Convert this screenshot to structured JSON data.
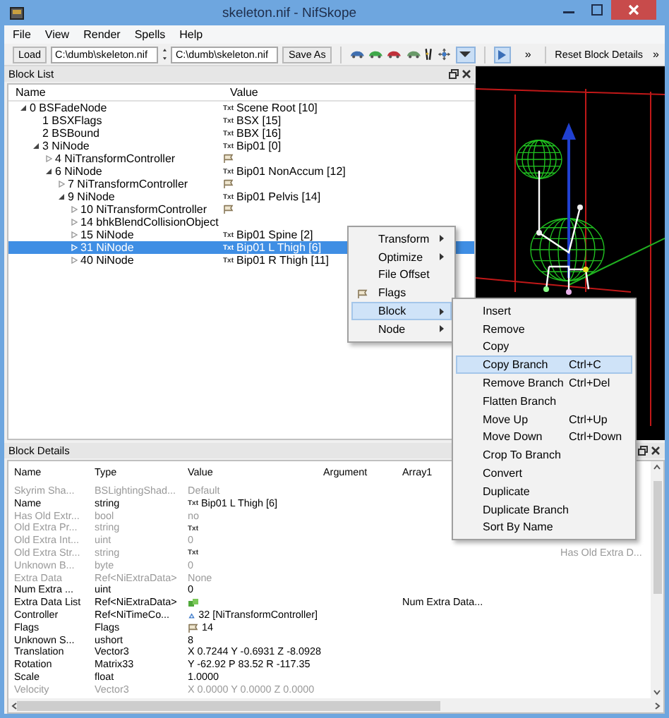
{
  "window": {
    "title": "skeleton.nif - NifSkope"
  },
  "menu": [
    "File",
    "View",
    "Render",
    "Spells",
    "Help"
  ],
  "toolbar": {
    "load": "Load",
    "fields": [
      "C:\\dumb\\skeleton.nif",
      "C:\\dumb\\skeleton.nif"
    ],
    "save": "Save As",
    "tools": [
      {
        "kind": "car",
        "color": "#3f6fb0"
      },
      {
        "kind": "car",
        "color": "#3fa84a"
      },
      {
        "kind": "car",
        "color": "#c0303a"
      },
      {
        "kind": "car",
        "color": "#6a9a6a"
      },
      {
        "kind": "figure"
      },
      {
        "kind": "move"
      },
      {
        "kind": "dropdown",
        "on": true
      }
    ],
    "play_on": true,
    "overflow": [
      "»",
      "»"
    ],
    "reset": "Reset Block Details"
  },
  "block_list": {
    "title": "Block List",
    "columns": [
      "Name",
      "Value"
    ],
    "nodes": [
      {
        "name": "0 BSFadeNode",
        "badge": "Txt",
        "value": "Scene Root [10]",
        "expanded": true,
        "selected": false,
        "children": [
          {
            "name": "1 BSXFlags",
            "badge": "Txt",
            "value": "BSX [15]",
            "selected": false
          },
          {
            "name": "2 BSBound",
            "badge": "Txt",
            "value": "BBX [16]",
            "selected": false
          },
          {
            "name": "3 NiNode",
            "badge": "Txt",
            "value": "Bip01 [0]",
            "expanded": true,
            "selected": false,
            "children": [
              {
                "name": "4 NiTransformController",
                "kind": "controller",
                "expanded": false,
                "selected": false
              },
              {
                "name": "6 NiNode",
                "badge": "Txt",
                "value": "Bip01 NonAccum [12]",
                "expanded": true,
                "selected": false,
                "children": [
                  {
                    "name": "7 NiTransformController",
                    "kind": "controller",
                    "expanded": false,
                    "selected": false
                  },
                  {
                    "name": "9 NiNode",
                    "badge": "Txt",
                    "value": "Bip01 Pelvis [14]",
                    "expanded": true,
                    "selected": false,
                    "children": [
                      {
                        "name": "10 NiTransformController",
                        "kind": "controller",
                        "expanded": false,
                        "selected": false
                      },
                      {
                        "name": "14 bhkBlendCollisionObject",
                        "expanded": false,
                        "selected": false
                      },
                      {
                        "name": "15 NiNode",
                        "badge": "Txt",
                        "value": "Bip01 Spine [2]",
                        "expanded": false,
                        "selected": false
                      },
                      {
                        "name": "31 NiNode",
                        "badge": "Txt",
                        "value": "Bip01 L Thigh [6]",
                        "expanded": false,
                        "selected": true
                      },
                      {
                        "name": "40 NiNode",
                        "badge": "Txt",
                        "value": "Bip01 R Thigh [11]",
                        "expanded": false,
                        "selected": false
                      }
                    ]
                  }
                ]
              }
            ]
          }
        ]
      }
    ]
  },
  "context_menu": [
    {
      "label": "Transform",
      "submenu": true,
      "selected": false
    },
    {
      "label": "Optimize",
      "submenu": true,
      "selected": false
    },
    {
      "label": "File Offset",
      "submenu": false,
      "selected": false
    },
    {
      "label": "Flags",
      "kind": "flags",
      "submenu": false,
      "selected": false
    },
    {
      "label": "Block",
      "submenu": true,
      "selected": true
    },
    {
      "label": "Node",
      "submenu": true,
      "selected": false
    }
  ],
  "submenu": [
    {
      "label": "Insert",
      "selected": false
    },
    {
      "label": "Remove",
      "selected": false
    },
    {
      "label": "Copy",
      "selected": false
    },
    {
      "label": "Copy Branch",
      "shortcut": "Ctrl+C",
      "selected": true
    },
    {
      "label": "Remove Branch",
      "shortcut": "Ctrl+Del",
      "selected": false
    },
    {
      "label": "Flatten Branch",
      "selected": false
    },
    {
      "label": "Move Up",
      "shortcut": "Ctrl+Up",
      "selected": false
    },
    {
      "label": "Move Down",
      "shortcut": "Ctrl+Down",
      "selected": false
    },
    {
      "label": "Crop To Branch",
      "selected": false
    },
    {
      "label": "Convert",
      "selected": false
    },
    {
      "label": "Duplicate",
      "selected": false
    },
    {
      "label": "Duplicate Branch",
      "selected": false
    },
    {
      "label": "Sort By Name",
      "selected": false
    }
  ],
  "block_details": {
    "title": "Block Details",
    "columns": [
      "Name",
      "Type",
      "Value",
      "Argument",
      "Array1"
    ],
    "rows": [
      {
        "name": "Skyrim Sha...",
        "type": "BSLightingShad...",
        "value": "Default",
        "disabled": true
      },
      {
        "name": "Name",
        "type": "string",
        "badge": "Txt",
        "value": "Bip01 L Thigh [6]",
        "disabled": false
      },
      {
        "name": "Has Old Extr...",
        "type": "bool",
        "value": "no",
        "disabled": true
      },
      {
        "name": "Old Extra Pr...",
        "type": "string",
        "badge": "Txt",
        "disabled": true
      },
      {
        "name": "Old Extra Int...",
        "type": "uint",
        "value": "0",
        "disabled": true
      },
      {
        "name": "Old Extra Str...",
        "type": "string",
        "badge": "Txt",
        "column_6": "Has Old Extra D...",
        "disabled": true
      },
      {
        "name": "Unknown B...",
        "type": "byte",
        "value": "0",
        "disabled": true
      },
      {
        "name": "Extra Data",
        "type": "Ref<NiExtraData>",
        "value": "None",
        "disabled": true
      },
      {
        "name": "Num Extra ...",
        "type": "uint",
        "value": "0",
        "disabled": false
      },
      {
        "name": "Extra Data List",
        "type": "Ref<NiExtraData>",
        "kind": "ref_list",
        "array1": "Num Extra Data...",
        "disabled": false
      },
      {
        "name": "Controller",
        "type": "Ref<NiTimeCo...",
        "kind": "ref",
        "value": "32 [NiTransformController]",
        "disabled": false
      },
      {
        "name": "Flags",
        "type": "Flags",
        "kind": "flags",
        "value": "14",
        "disabled": false
      },
      {
        "name": "Unknown S...",
        "type": "ushort",
        "value": "8",
        "disabled": false
      },
      {
        "name": "Translation",
        "type": "Vector3",
        "value": "X 0.7244 Y -0.6931 Z -8.0928",
        "disabled": false
      },
      {
        "name": "Rotation",
        "type": "Matrix33",
        "value": "Y -62.92 P 83.52 R -117.35",
        "disabled": false
      },
      {
        "name": "Scale",
        "type": "float",
        "value": "1.0000",
        "disabled": false
      },
      {
        "name": "Velocity",
        "type": "Vector3",
        "value": "X 0.0000 Y 0.0000 Z 0.0000",
        "disabled": true
      }
    ]
  }
}
